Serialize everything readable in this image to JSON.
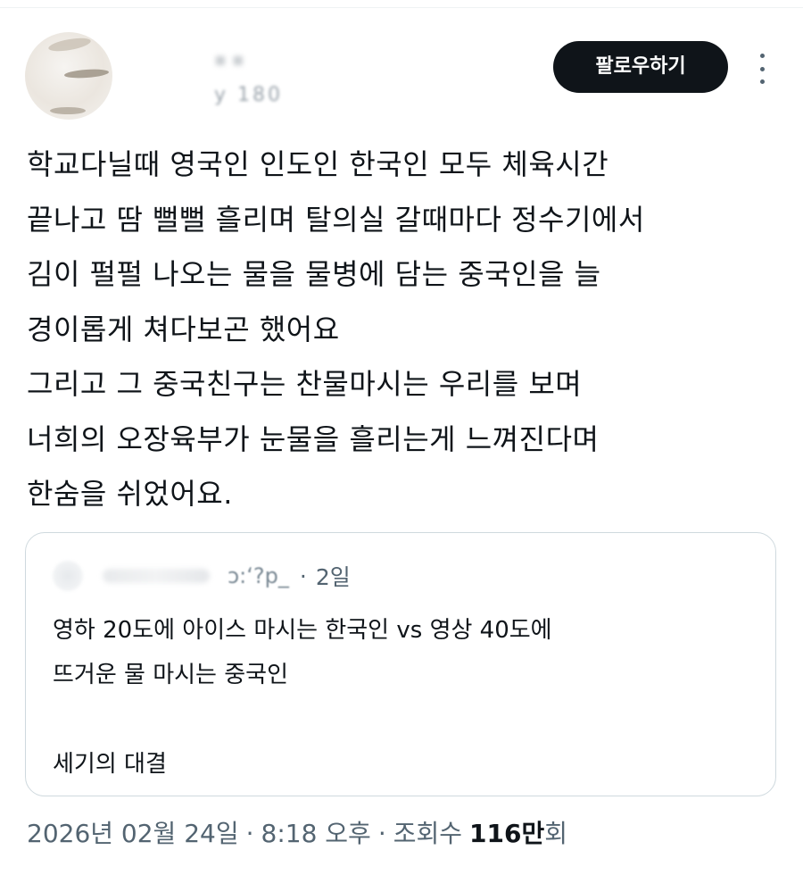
{
  "header": {
    "follow_label": "팔로우하기",
    "author_handle_fragment": "y  180"
  },
  "tweet": {
    "lines": [
      "학교다닐때 영국인 인도인 한국인 모두 체육시간",
      "끝나고 땀 뻘뻘 흘리며 탈의실 갈때마다 정수기에서",
      "김이 펄펄 나오는 물을 물병에 담는 중국인을 늘",
      "경이롭게 쳐다보곤 했어요",
      "그리고 그 중국친구는 찬물마시는 우리를 보며",
      "너희의 오장육부가 눈물을 흘리는게 느껴진다며",
      "한숨을 쉬었어요."
    ]
  },
  "quote": {
    "handle_fragment": "ɔ:ʻ?p_",
    "separator": "·",
    "time": "2일",
    "lines": [
      "영하 20도에 아이스 마시는 한국인 vs 영상 40도에",
      "뜨거운 물 마시는 중국인",
      "",
      "세기의 대결"
    ]
  },
  "meta": {
    "date": "2026년 02월 24일",
    "sep1": "·",
    "time": "8:18 오후",
    "sep2": "·",
    "views_label": "조회수",
    "views_count": "116만",
    "views_suffix": "회"
  }
}
